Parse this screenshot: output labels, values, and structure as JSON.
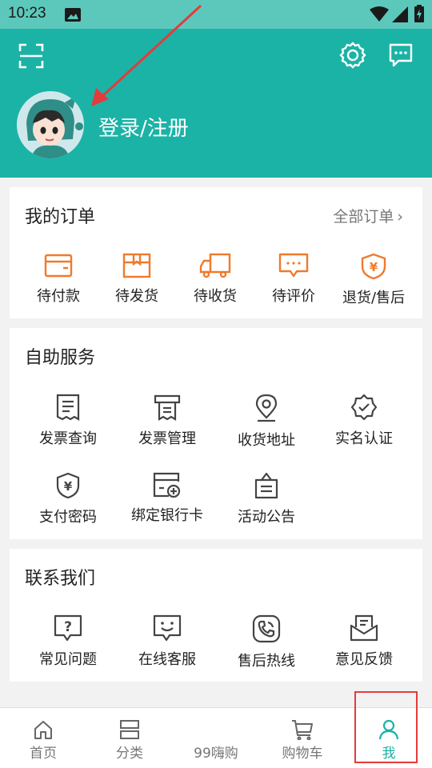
{
  "status_bar": {
    "time": "10:23"
  },
  "header": {
    "login_label": "登录/注册",
    "icons": [
      "scan-icon",
      "gear-icon",
      "message-icon"
    ],
    "background_color": "#1bb3a6"
  },
  "orders": {
    "title": "我的订单",
    "all_link": "全部订单",
    "items": [
      {
        "label": "待付款",
        "icon": "wallet-icon"
      },
      {
        "label": "待发货",
        "icon": "package-icon"
      },
      {
        "label": "待收货",
        "icon": "truck-icon"
      },
      {
        "label": "待评价",
        "icon": "comment-icon"
      },
      {
        "label": "退货/售后",
        "icon": "refund-shield-icon"
      }
    ],
    "icon_color": "#f07a2a"
  },
  "self_service": {
    "title": "自助服务",
    "items": [
      {
        "label": "发票查询",
        "icon": "invoice-icon"
      },
      {
        "label": "发票管理",
        "icon": "invoice-printer-icon"
      },
      {
        "label": "收货地址",
        "icon": "location-pin-icon"
      },
      {
        "label": "实名认证",
        "icon": "verified-badge-icon"
      },
      {
        "label": "支付密码",
        "icon": "yuan-shield-icon"
      },
      {
        "label": "绑定银行卡",
        "icon": "bank-card-add-icon"
      },
      {
        "label": "活动公告",
        "icon": "notice-board-icon"
      }
    ]
  },
  "contact": {
    "title": "联系我们",
    "items": [
      {
        "label": "常见问题",
        "icon": "question-icon"
      },
      {
        "label": "在线客服",
        "icon": "chat-face-icon"
      },
      {
        "label": "售后热线",
        "icon": "phone-icon"
      },
      {
        "label": "意见反馈",
        "icon": "feedback-mail-icon"
      }
    ]
  },
  "tabbar": {
    "tabs": [
      {
        "label": "首页",
        "icon": "home-icon"
      },
      {
        "label": "分类",
        "icon": "category-icon"
      },
      {
        "label": "99嗨购",
        "icon": ""
      },
      {
        "label": "购物车",
        "icon": "cart-icon"
      },
      {
        "label": "我",
        "icon": "person-icon",
        "active": true
      }
    ],
    "active_color": "#1bb3a6"
  },
  "annotation": {
    "highlight_color": "#e23c3c",
    "arrow_color": "#e23c3c"
  }
}
